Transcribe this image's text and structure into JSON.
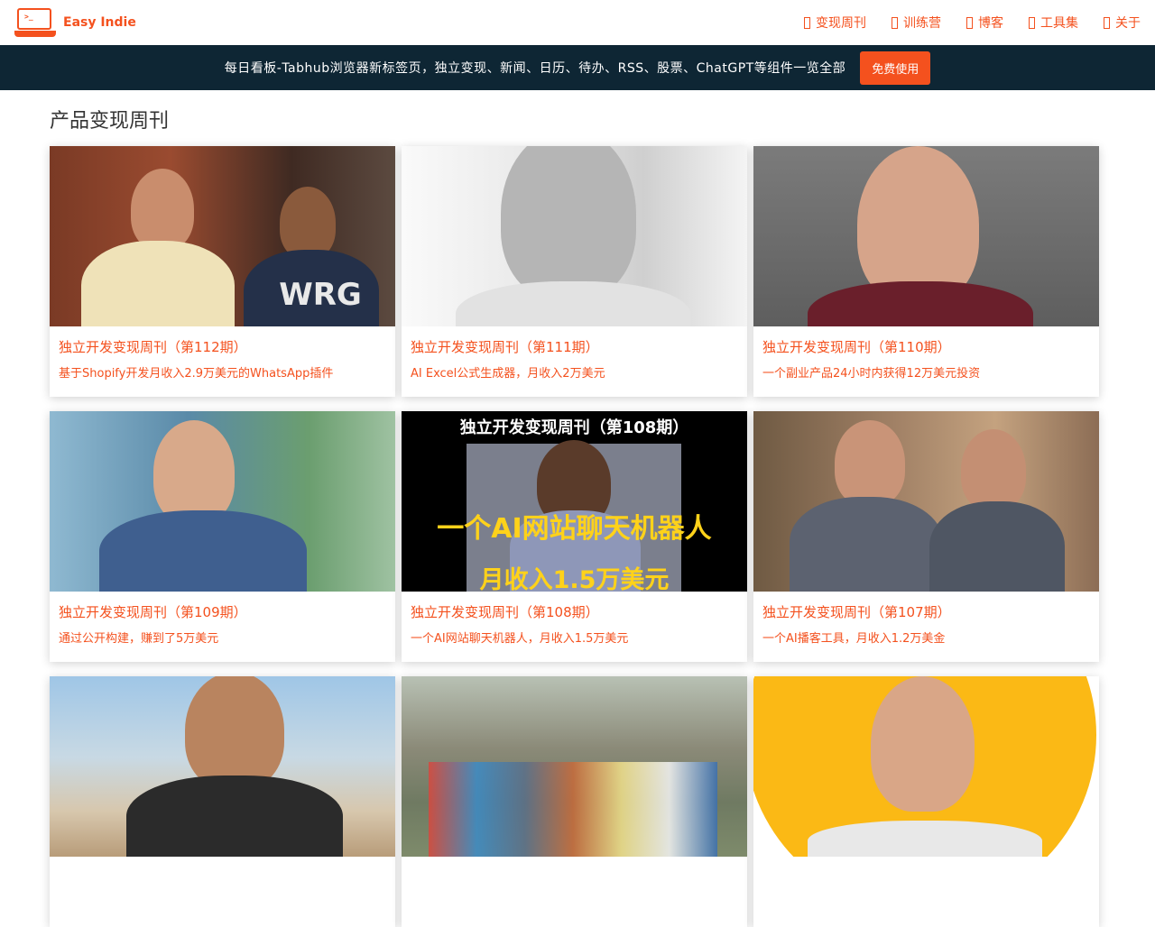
{
  "brand": {
    "name": "Easy Indie",
    "logo_text": ">_"
  },
  "nav": [
    {
      "label": "变现周刊"
    },
    {
      "label": "训练营"
    },
    {
      "label": "博客"
    },
    {
      "label": "工具集"
    },
    {
      "label": "关于"
    }
  ],
  "banner": {
    "text": "每日看板-Tabhub浏览器新标签页，独立变现、新闻、日历、待办、RSS、股票、ChatGPT等组件一览全部",
    "button": "免费使用"
  },
  "page_title": "产品变现周刊",
  "cards": [
    {
      "title": "独立开发变现周刊（第112期）",
      "desc": "基于Shopify开发月收入2.9万美元的WhatsApp插件",
      "thumb_text": "WRG"
    },
    {
      "title": "独立开发变现周刊（第111期）",
      "desc": "AI Excel公式生成器，月收入2万美元"
    },
    {
      "title": "独立开发变现周刊（第110期）",
      "desc": "一个副业产品24小时内获得12万美元投资"
    },
    {
      "title": "独立开发变现周刊（第109期）",
      "desc": "通过公开构建，赚到了5万美元"
    },
    {
      "title": "独立开发变现周刊（第108期）",
      "desc": "一个AI网站聊天机器人，月收入1.5万美元",
      "thumb_top": "独立开发变现周刊（第108期）",
      "thumb_mid": "一个AI网站聊天机器人",
      "thumb_bot": "月收入1.5万美元"
    },
    {
      "title": "独立开发变现周刊（第107期）",
      "desc": "一个AI播客工具，月收入1.2万美金"
    },
    {
      "title": "",
      "desc": ""
    },
    {
      "title": "",
      "desc": ""
    },
    {
      "title": "",
      "desc": ""
    }
  ]
}
